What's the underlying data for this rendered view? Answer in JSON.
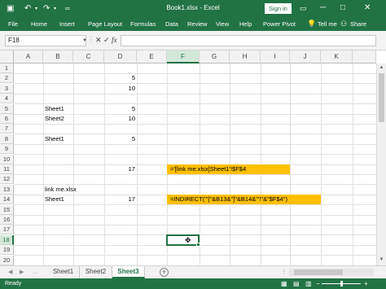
{
  "titlebar": {
    "title": "Book1.xlsx  -  Excel",
    "signin_label": "Sign in",
    "qat": [
      "save-icon",
      "undo-icon",
      "redo-icon",
      "customize-qat-icon"
    ],
    "restore_icon": "ribbon-display-icon",
    "minimize": "─",
    "maximize": "□",
    "close": "✕"
  },
  "ribbon": {
    "tabs": [
      "File",
      "Home",
      "Insert",
      "Page Layout",
      "Formulas",
      "Data",
      "Review",
      "View",
      "Help",
      "Power Pivot"
    ],
    "tellme_label": "Tell me",
    "share_label": "Share"
  },
  "formula_bar": {
    "name_box": "F18",
    "formula": ""
  },
  "grid": {
    "columns": [
      "A",
      "B",
      "C",
      "D",
      "E",
      "F",
      "G",
      "H",
      "I",
      "J",
      "K"
    ],
    "rows": [
      "1",
      "2",
      "3",
      "4",
      "5",
      "6",
      "7",
      "8",
      "9",
      "10",
      "11",
      "12",
      "13",
      "14",
      "15",
      "16",
      "17",
      "18",
      "19",
      "20"
    ],
    "selected_cell": "F18",
    "cells": {
      "D2": "5",
      "D3": "10",
      "B5": "Sheet1",
      "D5": "5",
      "B6": "Sheet2",
      "D6": "10",
      "B8": "Sheet1",
      "D8": "5",
      "D11": "17",
      "F11": "='[link me.xlsx]Sheet1'!$F$4",
      "B13": "link me.xlsx",
      "B14": "Sheet1",
      "D14": "17",
      "F14": "=INDIRECT(\"'[\"&B13&\"]\"&B14&\"'!\"&\"$F$4\")"
    }
  },
  "sheets": {
    "tabs": [
      "Sheet1",
      "Sheet2",
      "Sheet3"
    ],
    "active": "Sheet3"
  },
  "status": {
    "ready": "Ready"
  },
  "colors": {
    "excel_green": "#217346",
    "highlight": "#ffc000"
  }
}
